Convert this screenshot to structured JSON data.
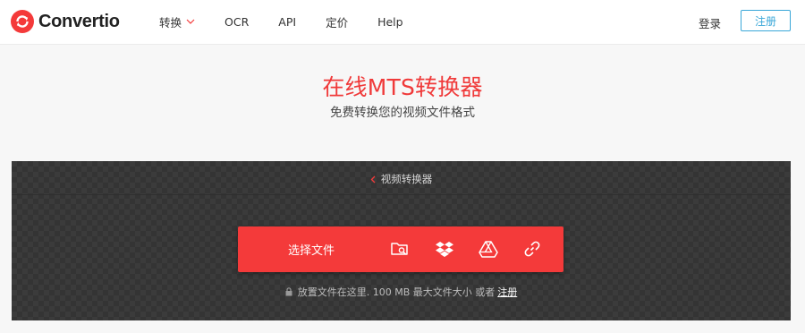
{
  "brand": {
    "name": "Convertio",
    "color": "#f43a3a"
  },
  "nav": {
    "items": [
      {
        "label": "转换",
        "has_dropdown": true
      },
      {
        "label": "OCR"
      },
      {
        "label": "API"
      },
      {
        "label": "定价"
      },
      {
        "label": "Help"
      }
    ]
  },
  "auth": {
    "login_label": "登录",
    "signup_label": "注册",
    "signup_color": "#3aa7d8"
  },
  "hero": {
    "title": "在线MTS转换器",
    "subtitle": "免费转换您的视频文件格式"
  },
  "converter": {
    "back_label": "视频转换器",
    "choose_file_label": "选择文件",
    "sources": [
      "folder-search-icon",
      "dropbox-icon",
      "google-drive-icon",
      "url-link-icon"
    ],
    "note_text": "放置文件在这里. 100 MB 最大文件大小 或者",
    "note_link": "注册"
  }
}
